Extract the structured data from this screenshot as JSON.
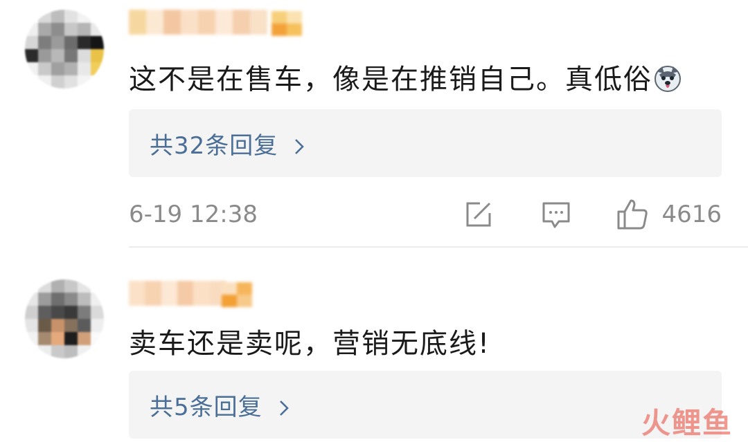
{
  "comments": [
    {
      "text": "这不是在售车，像是在推销自己。真低俗",
      "emoji": "husky-dog-emoji",
      "replies_label": "共32条回复",
      "time": "6-19 12:38",
      "likes": "4616"
    },
    {
      "text": "卖车还是卖呢，营销无底线!",
      "replies_label": "共5条回复"
    }
  ],
  "watermark": "火鲤鱼",
  "colors": {
    "link": "#4a6e96",
    "meta": "#8a8a8a",
    "reply_bg": "#f4f4f4",
    "watermark": "#e8473a"
  }
}
